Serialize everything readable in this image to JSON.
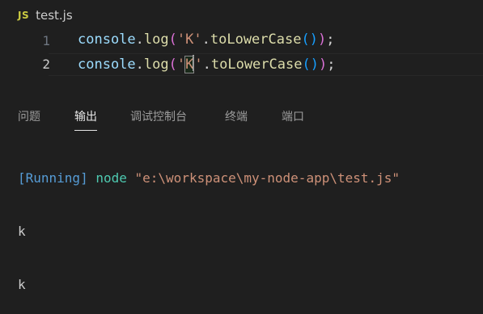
{
  "editor": {
    "file_icon": "JS",
    "file_name": "test.js",
    "lines": [
      {
        "number": "1",
        "var": "console",
        "dot1": ".",
        "fn": "log",
        "open": "(",
        "q1": "'",
        "char": "K",
        "q2": "'",
        "dot2": ".",
        "method": "toLowerCase",
        "inner": "()",
        "close": ")",
        "semi": ";"
      },
      {
        "number": "2",
        "var": "console",
        "dot1": ".",
        "fn": "log",
        "open": "(",
        "q1": "'",
        "char": "K",
        "q2": "'",
        "dot2": ".",
        "method": "toLowerCase",
        "inner": "()",
        "close": ")",
        "semi": ";"
      }
    ]
  },
  "panel": {
    "tabs": [
      {
        "label": "问题"
      },
      {
        "label": "输出",
        "active": true
      },
      {
        "label": "调试控制台"
      },
      {
        "label": "终端"
      },
      {
        "label": "端口"
      }
    ]
  },
  "output": {
    "status": "[Running]",
    "command": "node",
    "path": "\"e:\\workspace\\my-node-app\\test.js\"",
    "results": [
      "k",
      "k"
    ]
  }
}
